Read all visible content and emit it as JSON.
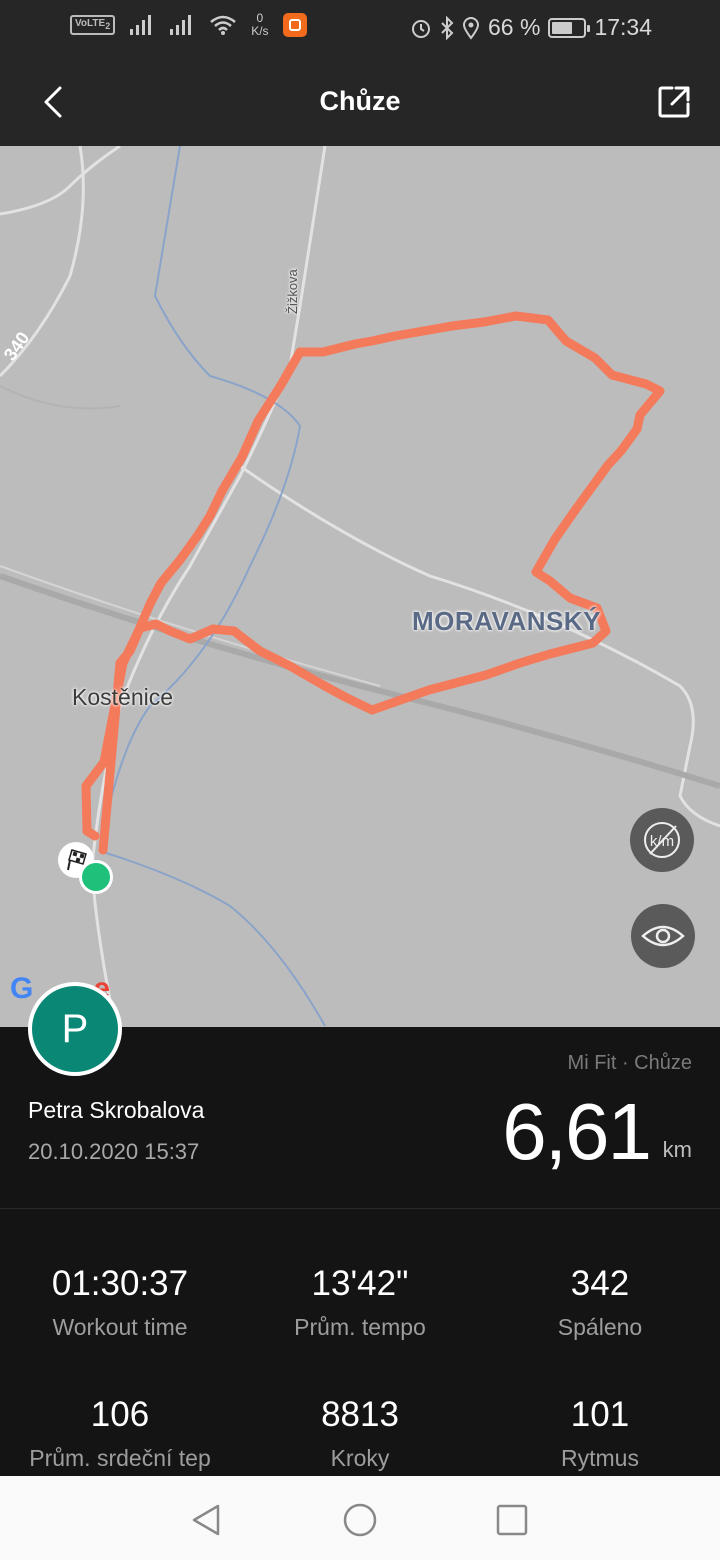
{
  "status_bar": {
    "volte_label": "VoLTE",
    "volte_sub": "2",
    "net_speed_value": "0",
    "net_speed_unit": "K/s",
    "battery_percent_text": "66 %",
    "battery_level": 0.66,
    "time": "17:34",
    "icons": [
      "signal-icon",
      "signal-icon",
      "wifi-icon",
      "app-badge-icon",
      "alarm-icon",
      "bluetooth-icon",
      "location-icon",
      "battery-icon"
    ]
  },
  "header": {
    "title": "Chůze",
    "back_icon": "chevron-left-icon",
    "share_icon": "share-external-icon"
  },
  "map": {
    "labels": {
      "town": "Kostěnice",
      "area": "MORAVANSKÝ",
      "street": "Žižkova",
      "road_number": "340"
    },
    "route_color": "#f47a5c",
    "provider": "Google",
    "buttons": {
      "units_toggle_icon": "km-hidden-icon",
      "visibility_icon": "eye-icon"
    }
  },
  "summary": {
    "avatar_letter": "P",
    "avatar_color": "#0b8776",
    "source": "Mi Fit · Chůze",
    "user_name": "Petra Skrobalova",
    "date": "20.10.2020 15:37",
    "distance": "6,61",
    "distance_unit": "km"
  },
  "stats": [
    {
      "value": "01:30:37",
      "label": "Workout time"
    },
    {
      "value": "13'42\"",
      "label": "Prům. tempo"
    },
    {
      "value": "342",
      "label": "Spáleno"
    },
    {
      "value": "106",
      "label": "Prům. srdeční tep"
    },
    {
      "value": "8813",
      "label": "Kroky"
    },
    {
      "value": "101",
      "label": "Rytmus"
    }
  ],
  "nav_bar": {
    "icons": [
      "back-triangle-icon",
      "home-circle-icon",
      "recents-square-icon"
    ]
  }
}
